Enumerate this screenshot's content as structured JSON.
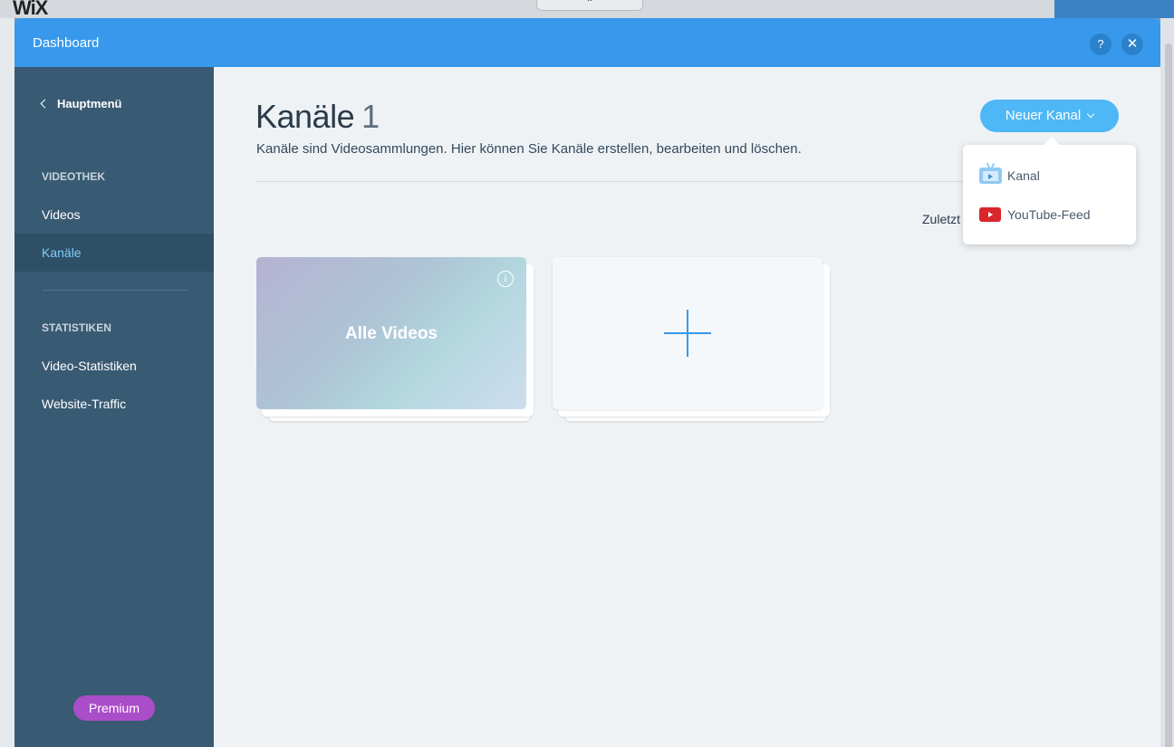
{
  "editor": {
    "logo": "WiX"
  },
  "modal": {
    "title": "Dashboard",
    "help_label": "?",
    "close_label": "✕"
  },
  "sidebar": {
    "back_label": "Hauptmenü",
    "section_1": "VIDEOTHEK",
    "items_1": [
      {
        "label": "Videos",
        "active": false
      },
      {
        "label": "Kanäle",
        "active": true
      }
    ],
    "section_2": "STATISTIKEN",
    "items_2": [
      {
        "label": "Video-Statistiken"
      },
      {
        "label": "Website-Traffic"
      }
    ],
    "premium_label": "Premium"
  },
  "main": {
    "title": "Kanäle",
    "title_count": "1",
    "subtitle": "Kanäle sind Videosammlungen. Hier können Sie Kanäle erstellen, bearbeiten und löschen.",
    "sort_label": "Zuletzt",
    "new_button_label": "Neuer Kanal",
    "dropdown": [
      {
        "label": "Kanal",
        "icon": "tv-icon"
      },
      {
        "label": "YouTube-Feed",
        "icon": "youtube-icon"
      }
    ],
    "cards": {
      "all_videos_label": "Alle Videos",
      "info_symbol": "i"
    }
  },
  "colors": {
    "header": "#3899ec",
    "sidebar": "#395a73",
    "sidebar_active": "#2f4f67",
    "active_text": "#7fccf7",
    "premium": "#aa4dc8",
    "button": "#4eb7f5",
    "youtube": "#d9262c"
  }
}
